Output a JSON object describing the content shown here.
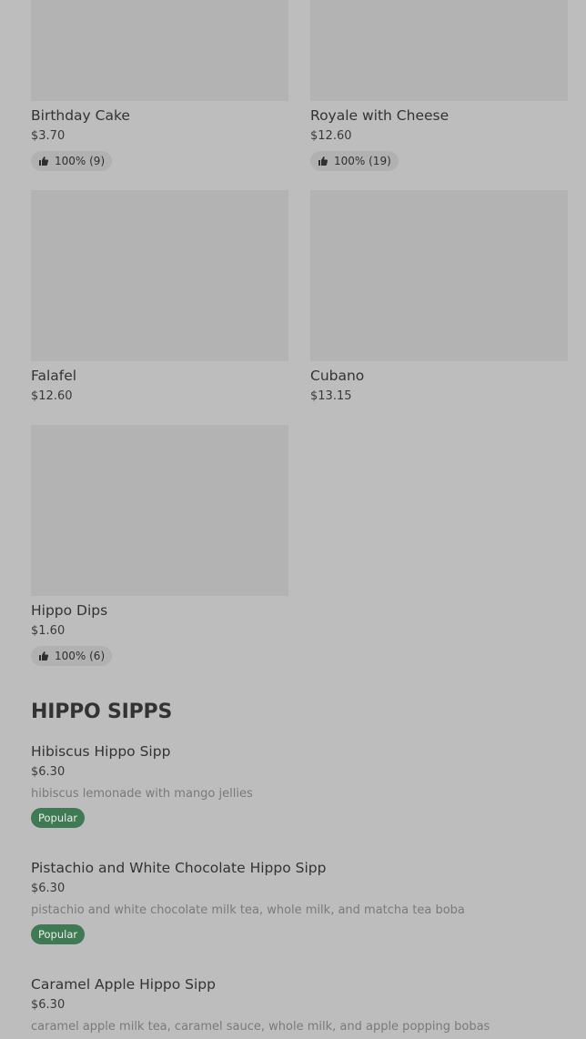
{
  "grid_items": [
    {
      "name": "Birthday Cake",
      "price": "$3.70",
      "rating": "100% (9)"
    },
    {
      "name": "Royale with Cheese",
      "price": "$12.60",
      "rating": "100% (19)"
    },
    {
      "name": "Falafel",
      "price": "$12.60"
    },
    {
      "name": "Cubano",
      "price": "$13.15"
    },
    {
      "name": "Hippo Dips",
      "price": "$1.60",
      "rating": "100% (6)"
    }
  ],
  "section": {
    "title": "HIPPO SIPPS"
  },
  "list_items": [
    {
      "name": "Hibiscus Hippo Sipp",
      "price": "$6.30",
      "description": "hibiscus lemonade with mango jellies",
      "badge": "Popular"
    },
    {
      "name": "Pistachio and White Chocolate Hippo Sipp",
      "price": "$6.30",
      "description": "pistachio and white chocolate milk tea, whole milk, and matcha tea boba",
      "badge": "Popular"
    },
    {
      "name": "Caramel Apple Hippo Sipp",
      "price": "$6.30",
      "description": "caramel apple milk tea, caramel sauce, whole milk, and apple popping bobas"
    }
  ],
  "colors": {
    "badge_bg": "#3f7a55",
    "page_bg": "#bdbdbd",
    "image_placeholder": "#b3b3b3"
  },
  "icons": {
    "rating": "thumbs-up-icon"
  }
}
